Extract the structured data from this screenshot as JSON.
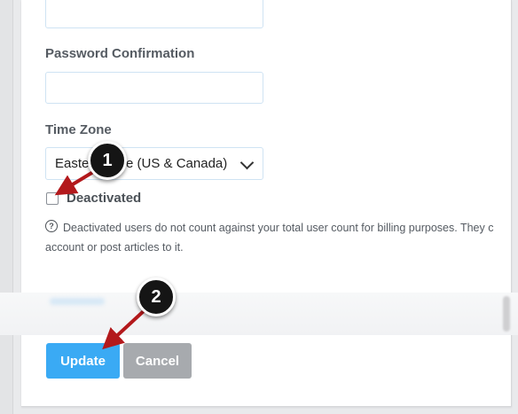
{
  "form": {
    "password_confirmation_label": "Password Confirmation",
    "password_confirmation_value": "",
    "time_zone_label": "Time Zone",
    "time_zone_value": "Eastern Time (US & Canada)",
    "deactivated_label": "Deactivated",
    "deactivated_checked": false,
    "help_text_line1": "Deactivated users do not count against your total user count for billing purposes. They c",
    "help_text_line2": "account or post articles to it."
  },
  "buttons": {
    "update_label": "Update",
    "cancel_label": "Cancel"
  },
  "callouts": {
    "first": "1",
    "second": "2"
  },
  "colors": {
    "update_button": "#3aaaf4",
    "cancel_button": "#a7aaae",
    "arrow": "#b3191c",
    "callout": "#151515"
  },
  "icons": {
    "help": "question-circle-icon",
    "select": "chevron-down-icon"
  }
}
